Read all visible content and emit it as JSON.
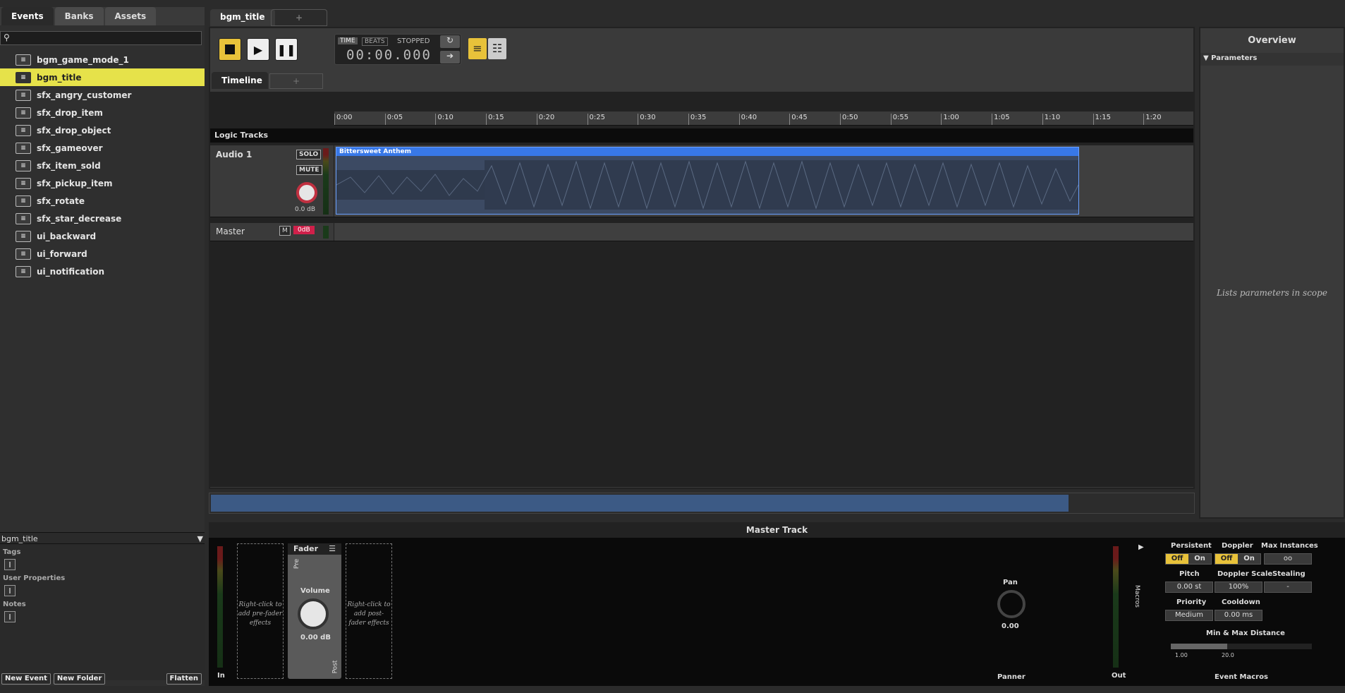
{
  "left": {
    "tabs": [
      "Events",
      "Banks",
      "Assets"
    ],
    "events": [
      "bgm_game_mode_1",
      "bgm_title",
      "sfx_angry_customer",
      "sfx_drop_item",
      "sfx_drop_object",
      "sfx_gameover",
      "sfx_item_sold",
      "sfx_pickup_item",
      "sfx_rotate",
      "sfx_star_decrease",
      "ui_backward",
      "ui_forward",
      "ui_notification"
    ],
    "selected_event": "bgm_title",
    "props": {
      "title": "bgm_title",
      "tags": "Tags",
      "user_props": "User Properties",
      "notes": "Notes"
    },
    "buttons": {
      "new_event": "New Event",
      "new_folder": "New Folder",
      "flatten": "Flatten"
    }
  },
  "doc": {
    "tab": "bgm_title",
    "add": "+"
  },
  "transport": {
    "time_label": "TIME",
    "beats_label": "BEATS",
    "status": "STOPPED",
    "time": "00:00.000"
  },
  "timeline": {
    "tab": "Timeline",
    "add": "+",
    "ticks": [
      "0:00",
      "0:05",
      "0:10",
      "0:15",
      "0:20",
      "0:25",
      "0:30",
      "0:35",
      "0:40",
      "0:45",
      "0:50",
      "0:55",
      "1:00",
      "1:05",
      "1:10",
      "1:15",
      "1:20"
    ],
    "logic": "Logic Tracks",
    "track1": {
      "name": "Audio 1",
      "solo": "SOLO",
      "mute": "MUTE",
      "vol": "0.0 dB",
      "region": "Bittersweet Anthem"
    },
    "master": {
      "name": "Master",
      "m": "M",
      "vol": "0dB"
    }
  },
  "overview": {
    "title": "Overview",
    "params": "Parameters",
    "hint": "Lists parameters in scope"
  },
  "master": {
    "title": "Master Track",
    "pre_fx": "Right-click to add pre-fader effects",
    "post_fx": "Right-click to add post-fader effects",
    "fader": "Fader",
    "pre": "Pre",
    "post": "Post",
    "volume": "Volume",
    "vol_val": "0.00 dB",
    "in": "In",
    "out": "Out",
    "pan": "Pan",
    "pan_val": "0.00",
    "panner": "Panner",
    "macros": "Macros",
    "persistent": "Persistent",
    "doppler": "Doppler",
    "max_instances": "Max Instances",
    "off": "Off",
    "on": "On",
    "max_val": "oo",
    "pitch": "Pitch",
    "pitch_val": "0.00 st",
    "doppler_scale": "Doppler Scale",
    "doppler_val": "100%",
    "stealing": "Stealing",
    "stealing_val": "-",
    "priority": "Priority",
    "priority_val": "Medium",
    "cooldown": "Cooldown",
    "cooldown_val": "0.00 ms",
    "distance": "Min & Max Distance",
    "min_val": "1.00",
    "max_dist": "20.0",
    "event_macros": "Event Macros"
  }
}
